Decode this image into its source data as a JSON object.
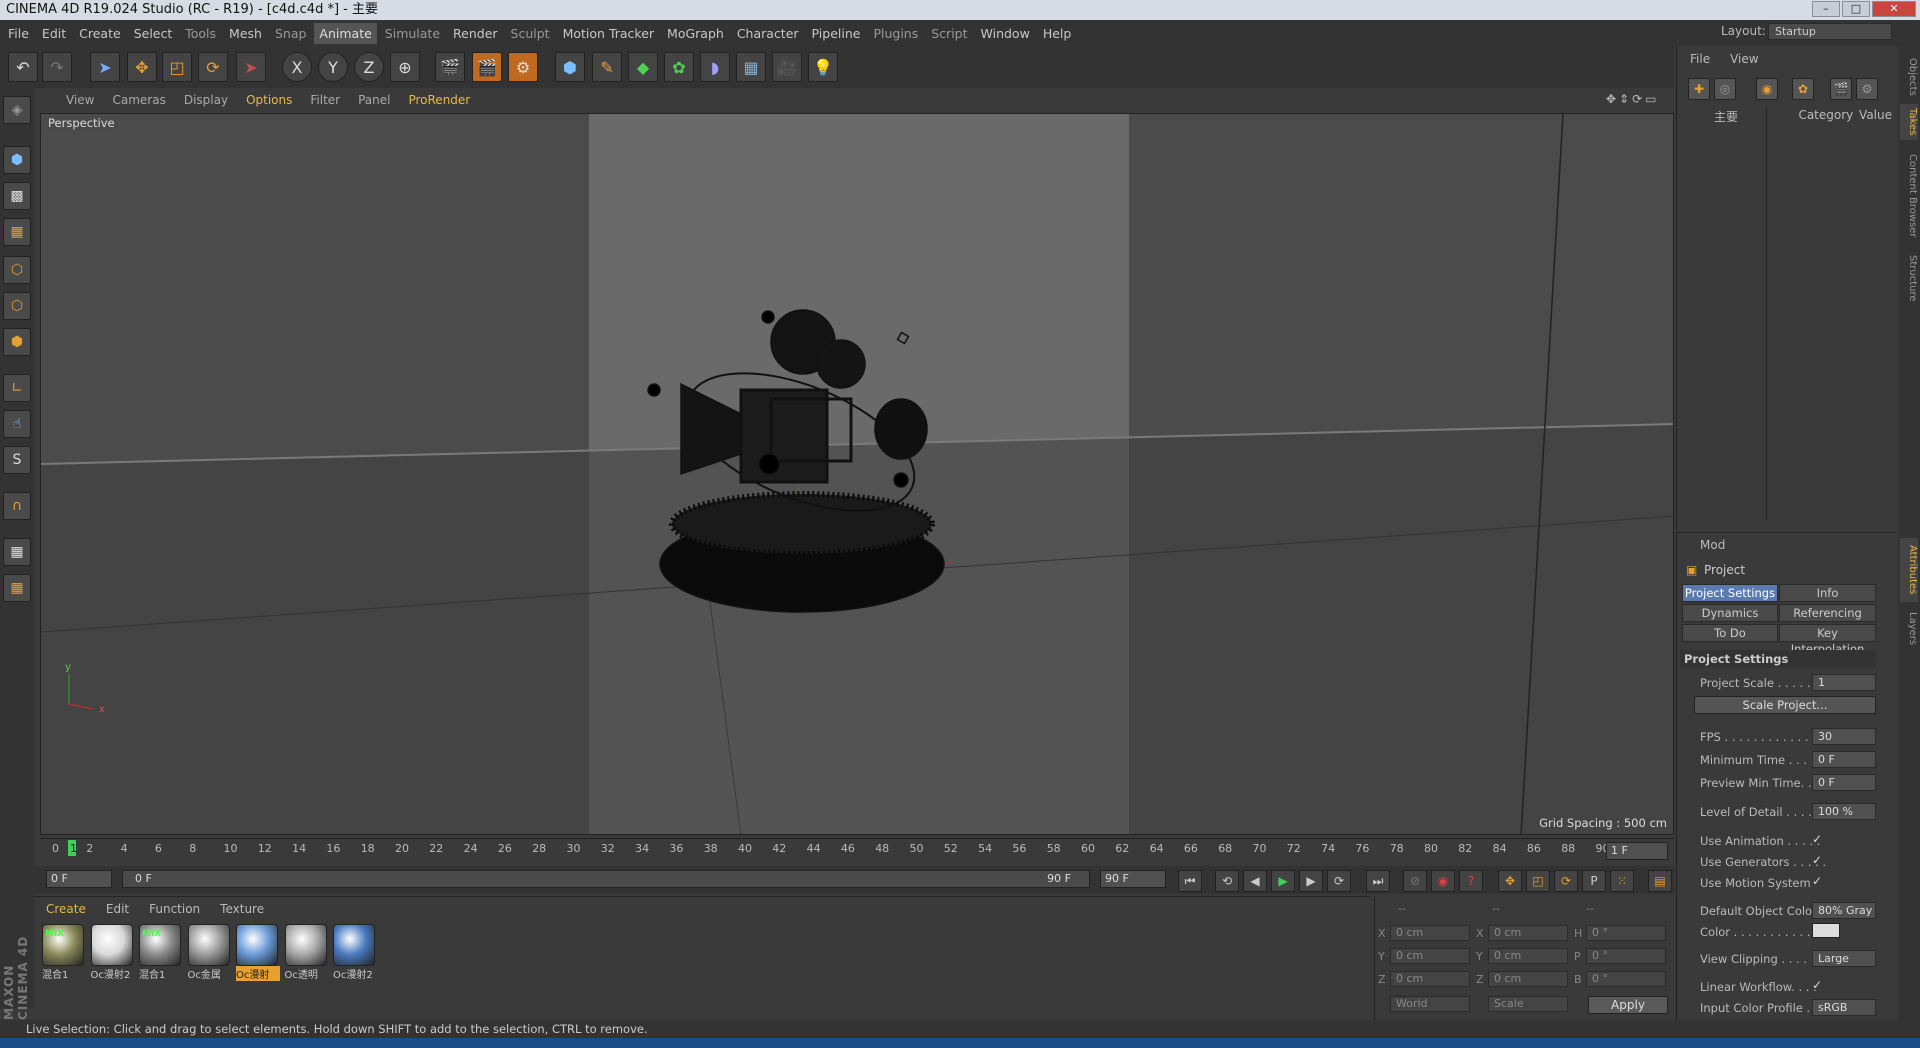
{
  "window": {
    "title": "CINEMA 4D R19.024 Studio (RC - R19) - [c4d.c4d *] - 主要",
    "buttons": [
      "–",
      "□",
      "✕"
    ]
  },
  "menu": [
    "File",
    "Edit",
    "Create",
    "Select",
    "Tools",
    "Mesh",
    "Snap",
    "Animate",
    "Simulate",
    "Render",
    "Sculpt",
    "Motion Tracker",
    "MoGraph",
    "Character",
    "Pipeline",
    "Plugins",
    "Script",
    "Window",
    "Help"
  ],
  "menu_active": "Animate",
  "layout": {
    "label": "Layout:",
    "value": "Startup"
  },
  "toolbar_icons": [
    "undo-icon",
    "redo-icon",
    "live-selection-icon",
    "move-icon",
    "scale-icon",
    "rotate-icon",
    "recent-tool-icon",
    "x-axis-icon",
    "y-axis-icon",
    "z-axis-icon",
    "world-coordinates-icon",
    "render-view-icon",
    "render-picture-viewer-icon",
    "edit-render-settings-icon",
    "cube-icon",
    "pen-icon",
    "subdivision-icon",
    "array-icon",
    "deformer-icon",
    "floor-icon",
    "camera-icon",
    "light-icon"
  ],
  "toolbar_glyphs": {
    "x": "X",
    "y": "Y",
    "z": "Z"
  },
  "viewport": {
    "menu": [
      "View",
      "Cameras",
      "Display",
      "Options",
      "Filter",
      "Panel",
      "ProRender"
    ],
    "menu_highlight": "Options",
    "label": "Perspective",
    "grid_spacing": "Grid Spacing : 500 cm",
    "axis_y": "y",
    "axis_x": "x"
  },
  "timeline": {
    "ticks": [
      "0",
      "2",
      "4",
      "6",
      "8",
      "10",
      "12",
      "14",
      "16",
      "18",
      "20",
      "22",
      "24",
      "26",
      "28",
      "30",
      "32",
      "34",
      "36",
      "38",
      "40",
      "42",
      "44",
      "46",
      "48",
      "50",
      "52",
      "54",
      "56",
      "58",
      "60",
      "62",
      "64",
      "66",
      "68",
      "70",
      "72",
      "74",
      "76",
      "78",
      "80",
      "82",
      "84",
      "86",
      "88",
      "90"
    ],
    "current_marker": "1",
    "current_frame": "1 F",
    "start_field": "0 F",
    "range_start": "0 F",
    "range_end": "90 F",
    "end_field": "90 F"
  },
  "materials": {
    "menu": [
      "Create",
      "Edit",
      "Function",
      "Texture"
    ],
    "menu_highlight": "Create",
    "items": [
      {
        "name": "混合1",
        "color": "#8a8a5a",
        "mix": "MIX",
        "selected": false
      },
      {
        "name": "Oc漫射2",
        "color": "#d8d8d8",
        "mix": "",
        "selected": false
      },
      {
        "name": "混合1",
        "color": "#8a8a8a",
        "mix": "MIX",
        "selected": false
      },
      {
        "name": "Oc金属",
        "color": "#9a9a9a",
        "mix": "",
        "selected": false
      },
      {
        "name": "Oc漫射",
        "color": "#6a9ad8",
        "mix": "",
        "selected": true
      },
      {
        "name": "Oc透明",
        "color": "#a8a8a8",
        "mix": "",
        "selected": false
      },
      {
        "name": "Oc漫射2",
        "color": "#4a7ac0",
        "mix": "",
        "selected": false
      }
    ]
  },
  "coordinates": {
    "header": [
      "--",
      "--",
      "--"
    ],
    "rows": [
      {
        "a": "X",
        "av": "0 cm",
        "b": "X",
        "bv": "0 cm",
        "c": "H",
        "cv": "0 °"
      },
      {
        "a": "Y",
        "av": "0 cm",
        "b": "Y",
        "bv": "0 cm",
        "c": "P",
        "cv": "0 °"
      },
      {
        "a": "Z",
        "av": "0 cm",
        "b": "Z",
        "bv": "0 cm",
        "c": "B",
        "cv": "0 °"
      }
    ],
    "mode1": "World",
    "mode2": "Scale",
    "apply": "Apply"
  },
  "objects": {
    "menu": [
      "File",
      "View"
    ],
    "columns": [
      "主要",
      "Category",
      "Value"
    ]
  },
  "attributes": {
    "mode": "Mod",
    "title": "Project",
    "tabs": [
      [
        "Project Settings",
        "Info"
      ],
      [
        "Dynamics",
        "Referencing"
      ],
      [
        "To Do",
        "Key Interpolation"
      ]
    ],
    "section": "Project Settings",
    "project_scale": {
      "label": "Project Scale . . . . . . .",
      "value": "1"
    },
    "scale_button": "Scale Project...",
    "fps": {
      "label": "FPS . . . . . . . . . . . . . . .",
      "value": "30"
    },
    "min_time": {
      "label": "Minimum Time . . . . .",
      "value": "0 F"
    },
    "preview_min": {
      "label": "Preview Min Time. . .",
      "value": "0 F"
    },
    "lod": {
      "label": "Level of Detail . . . . . .",
      "value": "100 %"
    },
    "use_animation": {
      "label": "Use Animation . . . . .",
      "value": "✓"
    },
    "use_generators": {
      "label": "Use Generators . . . . .",
      "value": "✓"
    },
    "use_motion": {
      "label": "Use Motion System",
      "value": "✓"
    },
    "default_color": {
      "label": "Default Object Color",
      "value": "80% Gray"
    },
    "color": {
      "label": "Color . . . . . . . . . . .",
      "value": ""
    },
    "clipping": {
      "label": "View Clipping . . . . . .",
      "value": "Large"
    },
    "linear": {
      "label": "Linear Workflow. . . .",
      "value": "✓"
    },
    "profile": {
      "label": "Input Color Profile . . .",
      "value": "sRGB"
    }
  },
  "right_tabs": [
    "Objects",
    "Takes",
    "Content Browser",
    "Structure",
    "Attributes",
    "Layers"
  ],
  "status": "Live Selection: Click and drag to select elements. Hold down SHIFT to add to the selection, CTRL to remove.",
  "brand": "MAXON CINEMA 4D"
}
